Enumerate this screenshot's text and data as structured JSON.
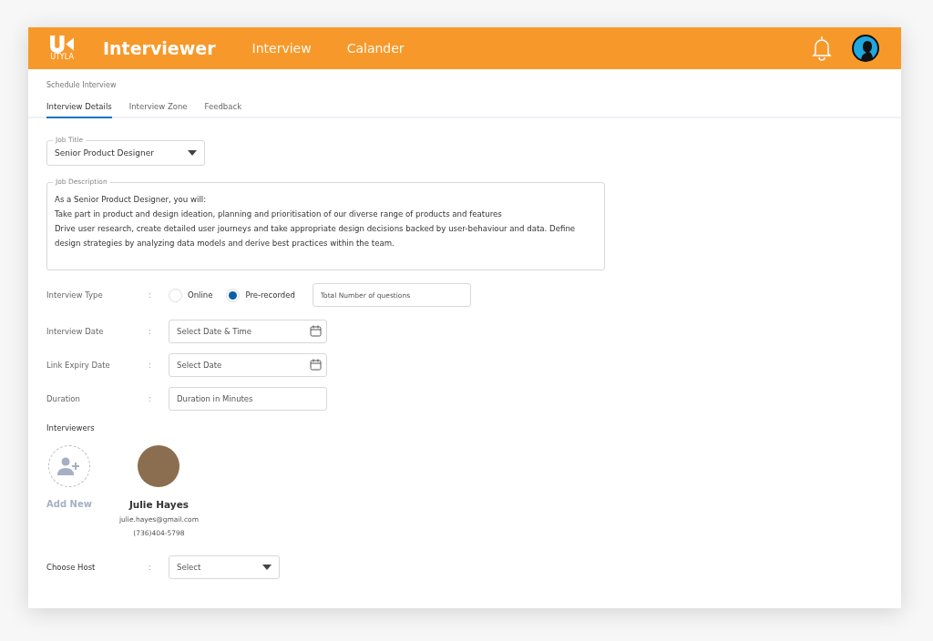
{
  "header": {
    "logo_text": "UTYLA",
    "title": "Interviewer",
    "nav": [
      {
        "label": "Interview"
      },
      {
        "label": "Calander"
      }
    ]
  },
  "breadcrumb": "Schedule Interview",
  "tabs": [
    {
      "label": "Interview Details",
      "selected": true
    },
    {
      "label": "Interview Zone",
      "selected": false
    },
    {
      "label": "Feedback",
      "selected": false
    }
  ],
  "job_title": {
    "label": "Job Title",
    "value": "Senior Product Designer"
  },
  "job_description": {
    "label": "Job Description",
    "lines": [
      "As a Senior Product Designer, you will:",
      "Take part in product and design ideation, planning and prioritisation of our diverse range of products and features",
      "Drive user research, create detailed user journeys and take appropriate design decisions backed by user-behaviour and data. Define design strategies by analyzing data models and derive best practices within the team."
    ]
  },
  "interview_type": {
    "label": "Interview Type",
    "colon": ":",
    "options": [
      {
        "label": "Online",
        "selected": false
      },
      {
        "label": "Pre-recorded",
        "selected": true
      }
    ],
    "questions_field": {
      "placeholder": "Total Number of questions"
    }
  },
  "fields": [
    {
      "label": "Interview Date",
      "colon": ":",
      "placeholder": "Select Date & Time",
      "kind": "date"
    },
    {
      "label": "Link Expiry Date",
      "colon": ":",
      "placeholder": "Select Date",
      "kind": "date"
    },
    {
      "label": "Duration",
      "colon": ":",
      "placeholder": "Duration in Minutes",
      "kind": "text"
    }
  ],
  "interviewers": {
    "label": "Interviewers",
    "add_label": "Add New",
    "people": [
      {
        "name": "Julie Hayes",
        "email": "julie.hayes@gmail.com",
        "phone": "(736)404-5798"
      }
    ]
  },
  "choose_host": {
    "label": "Choose Host",
    "colon": ":",
    "placeholder": "Select"
  }
}
